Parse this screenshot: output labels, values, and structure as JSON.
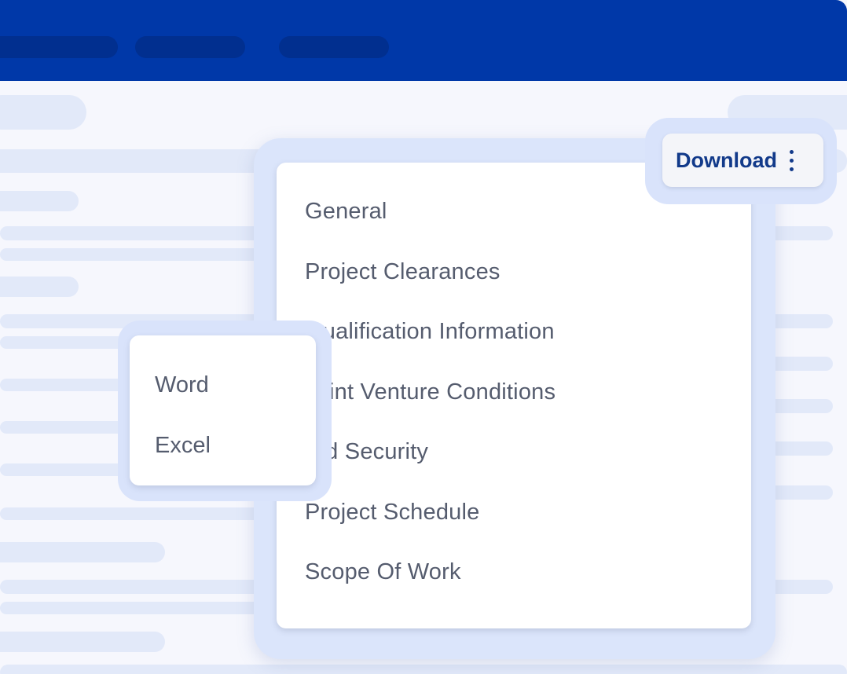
{
  "download_button": {
    "label": "Download",
    "icon": "more-vertical-icon"
  },
  "dropdown": {
    "items": [
      {
        "label": "General"
      },
      {
        "label": "Project Clearances"
      },
      {
        "label": "Qualification Information"
      },
      {
        "label": "Joint Venture Conditions"
      },
      {
        "label": "Bid Security"
      },
      {
        "label": "Project Schedule"
      },
      {
        "label": "Scope Of Work"
      }
    ]
  },
  "format_menu": {
    "items": [
      {
        "label": "Word"
      },
      {
        "label": "Excel"
      }
    ]
  },
  "colors": {
    "header": "#0038a8",
    "accent_text": "#123a8a",
    "menu_text": "#555c6e",
    "highlight": "#dbe5fb"
  }
}
